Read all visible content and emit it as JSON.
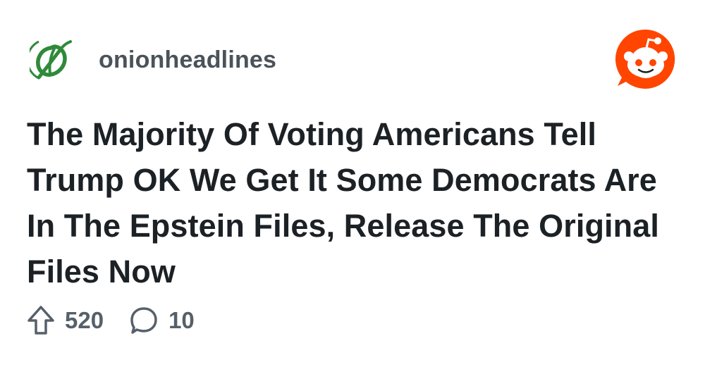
{
  "post": {
    "community": {
      "name": "onionheadlines",
      "avatar_icon": "onion-logo-icon",
      "avatar_color": "#2f8a3a"
    },
    "brand": {
      "icon": "reddit-logo-icon",
      "color": "#ff4500"
    },
    "title": "The Majority Of Voting Americans Tell Trump OK We Get It Some Democrats Are In The Epstein Files, Release The Original Files Now",
    "stats": {
      "upvotes": "520",
      "upvote_icon": "upvote-arrow-icon",
      "comments": "10",
      "comment_icon": "comment-bubble-icon"
    }
  }
}
